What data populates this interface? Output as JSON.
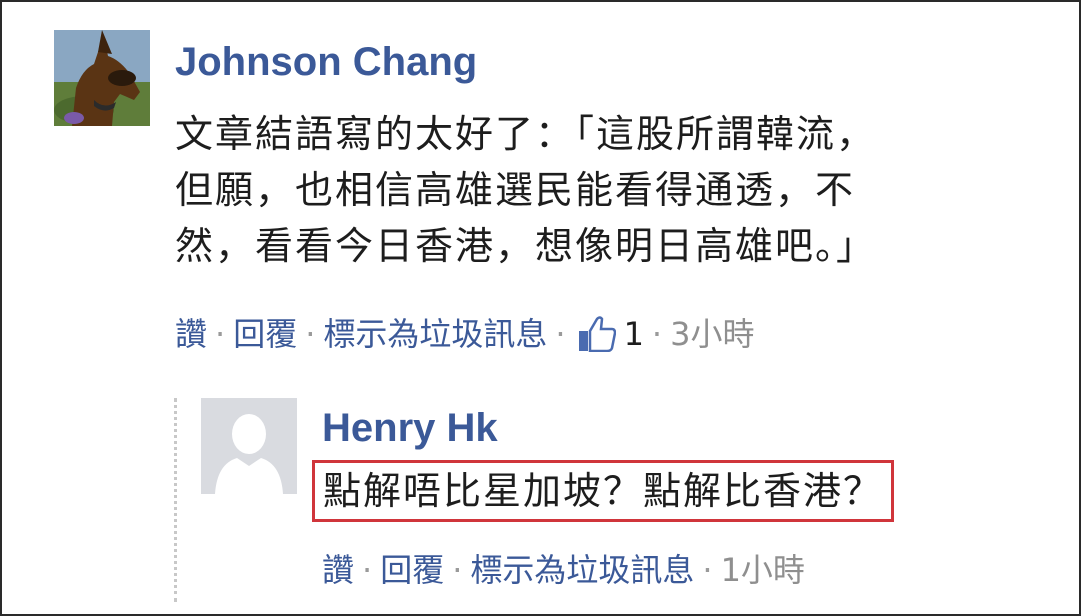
{
  "comment": {
    "author": "Johnson Chang",
    "avatar_icon": "dog-photo-avatar",
    "text_lines": [
      "文章結語寫的太好了：「這股所謂韓流，",
      "但願，也相信高雄選民能看得通透，不",
      "然，看看今日香港，想像明日高雄吧。」"
    ],
    "actions": {
      "like": "讚",
      "reply": "回覆",
      "report": "標示為垃圾訊息",
      "like_count": "1",
      "time": "3小時"
    }
  },
  "reply": {
    "author": "Henry Hk",
    "avatar_icon": "default-profile-silhouette",
    "text": "點解唔比星加坡？點解比香港？",
    "actions": {
      "like": "讚",
      "reply": "回覆",
      "report": "標示為垃圾訊息",
      "time": "1小時"
    }
  },
  "separator": "·",
  "colors": {
    "link": "#3b5998",
    "muted": "#8f8f8f",
    "highlight_border": "#d0353b",
    "avatar_placeholder": "#d9dbe0"
  }
}
